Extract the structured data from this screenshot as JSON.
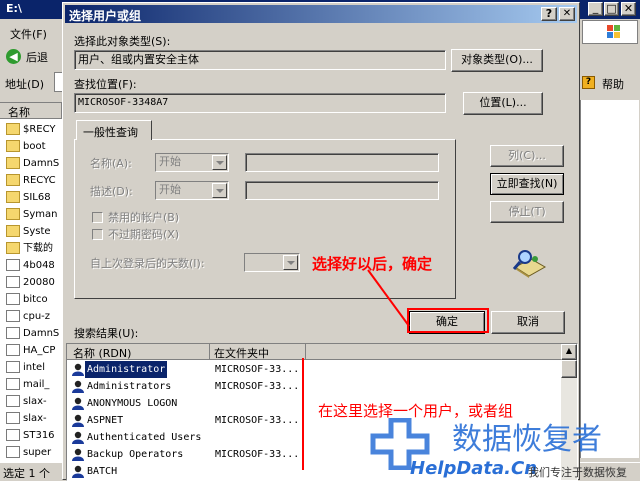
{
  "background_window": {
    "title": "E:\\",
    "menu_file": "文件(F)",
    "back_label": "后退",
    "address_label": "地址(D)",
    "column_name": "名称",
    "help_label": "帮助",
    "status_text": "选定 1 个",
    "items": [
      "$RECY",
      "boot",
      "DamnS",
      "RECYC",
      "SIL68",
      "Syman",
      "Syste",
      "下载的",
      "4b048",
      "20080",
      "bitco",
      "cpu-z",
      "DamnS",
      "HA_CP",
      "intel",
      "mail_",
      "slax-",
      "slax-",
      "ST316",
      "super"
    ]
  },
  "dialog": {
    "title": "选择用户或组",
    "help_btn": "?",
    "close_btn": "✕",
    "object_type_label": "选择此对象类型(S):",
    "object_type_value": "用户、组或内置安全主体",
    "object_type_button": "对象类型(O)...",
    "location_label": "查找位置(F):",
    "location_value": "MICROSOF-3348A7",
    "location_button": "位置(L)...",
    "tab_label": "一般性查询",
    "name_label": "名称(A):",
    "name_combo": "开始",
    "desc_label": "描述(D):",
    "desc_combo": "开始",
    "disabled_accounts": "禁用的帐户(B)",
    "non_expiring": "不过期密码(X)",
    "days_label": "自上次登录后的天数(I):",
    "columns_button": "列(C)...",
    "find_now_button": "立即查找(N)",
    "stop_button": "停止(T)",
    "ok_button": "确定",
    "cancel_button": "取消",
    "results_label": "搜索结果(U):",
    "results_columns": [
      "名称 (RDN)",
      "在文件夹中"
    ],
    "results": [
      {
        "name": "Administrator",
        "folder": "MICROSOF-33..."
      },
      {
        "name": "Administrators",
        "folder": "MICROSOF-33..."
      },
      {
        "name": "ANONYMOUS LOGON",
        "folder": ""
      },
      {
        "name": "ASPNET",
        "folder": "MICROSOF-33..."
      },
      {
        "name": "Authenticated Users",
        "folder": ""
      },
      {
        "name": "Backup Operators",
        "folder": "MICROSOF-33..."
      },
      {
        "name": "BATCH",
        "folder": ""
      }
    ]
  },
  "annotations": {
    "note_ok": "选择好以后，确定",
    "note_select": "在这里选择一个用户，或者组",
    "annotation_color": "#ff0000"
  },
  "watermark": {
    "cn": "数据恢复者",
    "site": "HelpData.Cn",
    "slogan": "我们专注于数据恢复"
  }
}
